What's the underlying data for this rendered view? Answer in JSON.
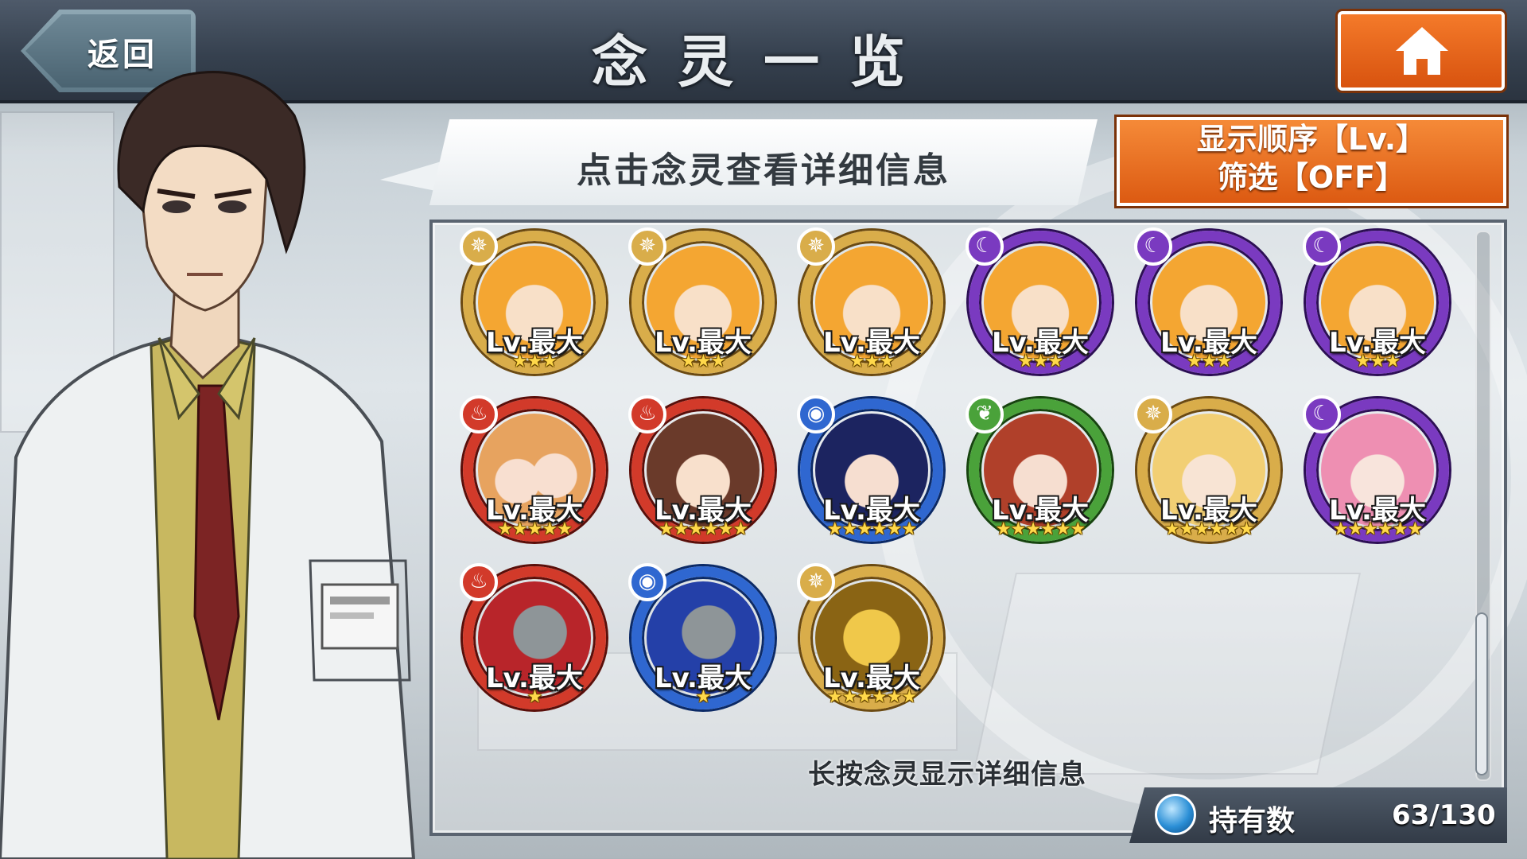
{
  "header": {
    "back_label": "返回",
    "title": "念灵一览"
  },
  "banner": {
    "text": "点击念灵查看详细信息"
  },
  "sort": {
    "line1": "显示顺序【Lv.】",
    "line2": "筛选【OFF】"
  },
  "hint": "长按念灵显示详细信息",
  "owned": {
    "label": "持有数",
    "value": "63/130"
  },
  "colors": {
    "light": "#c99a3c",
    "dark": "#6a2fa8",
    "fire": "#c83224",
    "water": "#2a5fc4",
    "wood": "#3f9a32",
    "header": "#36414f",
    "button": "#e0611a"
  },
  "tiles": [
    {
      "attr": "light",
      "attr_icon": "✵",
      "lv": "Lv.最大",
      "stars": "★★★",
      "portrait": "orange-hair-boy"
    },
    {
      "attr": "light",
      "attr_icon": "✵",
      "lv": "Lv.最大",
      "stars": "★★★",
      "portrait": "orange-hair-boy"
    },
    {
      "attr": "light",
      "attr_icon": "✵",
      "lv": "Lv.最大",
      "stars": "★★★",
      "portrait": "orange-hair-boy"
    },
    {
      "attr": "dark",
      "attr_icon": "☾",
      "lv": "Lv.最大",
      "stars": "★★★",
      "portrait": "orange-hair-boy"
    },
    {
      "attr": "dark",
      "attr_icon": "☾",
      "lv": "Lv.最大",
      "stars": "★★★",
      "portrait": "orange-hair-boy"
    },
    {
      "attr": "dark",
      "attr_icon": "☾",
      "lv": "Lv.最大",
      "stars": "★★★",
      "portrait": "orange-hair-boy"
    },
    {
      "attr": "fire",
      "attr_icon": "♨",
      "lv": "Lv.最大",
      "stars": "★★★★★",
      "portrait": "twins"
    },
    {
      "attr": "fire",
      "attr_icon": "♨",
      "lv": "Lv.最大",
      "stars": "★★★★★★",
      "portrait": "brown-hair-girl"
    },
    {
      "attr": "water",
      "attr_icon": "◉",
      "lv": "Lv.最大",
      "stars": "★★★★★★",
      "portrait": "navy-hair-girl"
    },
    {
      "attr": "wood",
      "attr_icon": "❦",
      "lv": "Lv.最大",
      "stars": "★★★★★★",
      "portrait": "red-hair-girl"
    },
    {
      "attr": "light",
      "attr_icon": "✵",
      "lv": "Lv.最大",
      "stars": "★★★★★★",
      "portrait": "blonde-girl"
    },
    {
      "attr": "dark",
      "attr_icon": "☾",
      "lv": "Lv.最大",
      "stars": "★★★★★★",
      "portrait": "pink-hair-girl"
    },
    {
      "attr": "fire",
      "attr_icon": "♨",
      "lv": "Lv.最大",
      "stars": "★",
      "portrait": "red-wolf"
    },
    {
      "attr": "water",
      "attr_icon": "◉",
      "lv": "Lv.最大",
      "stars": "★",
      "portrait": "blue-wolf"
    },
    {
      "attr": "light",
      "attr_icon": "✵",
      "lv": "Lv.最大",
      "stars": "★★★★★★",
      "portrait": "golden-dragon"
    }
  ]
}
